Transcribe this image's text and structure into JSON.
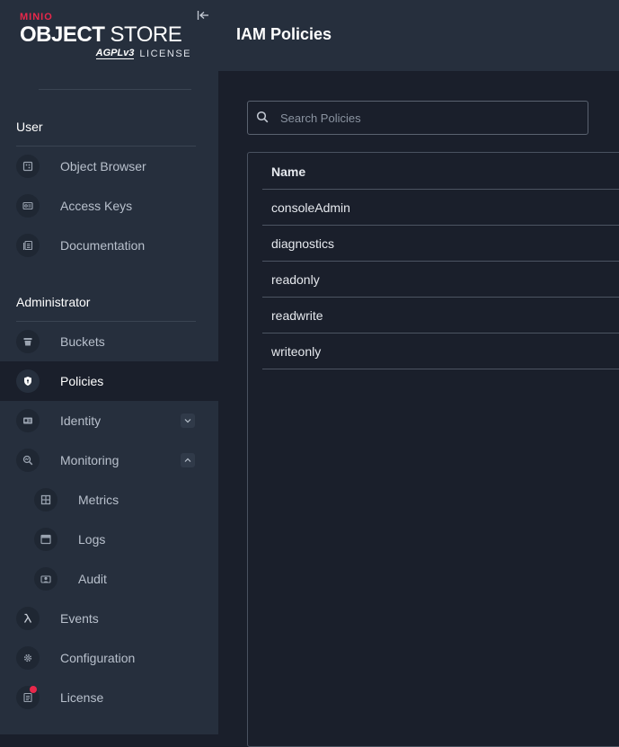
{
  "brand": {
    "company": "MINIO",
    "product_bold": "OBJECT",
    "product_thin": "STORE",
    "license_badge": "AGPLv3",
    "license_word": "LICENSE"
  },
  "sidebar": {
    "sections": {
      "user": "User",
      "administrator": "Administrator"
    },
    "user_items": [
      {
        "label": "Object Browser",
        "icon": "object-browser-icon"
      },
      {
        "label": "Access Keys",
        "icon": "access-keys-icon"
      },
      {
        "label": "Documentation",
        "icon": "documentation-icon"
      }
    ],
    "admin_items": [
      {
        "label": "Buckets",
        "icon": "bucket-icon"
      },
      {
        "label": "Policies",
        "icon": "shield-icon",
        "active": true
      },
      {
        "label": "Identity",
        "icon": "id-card-icon",
        "expanded": false
      },
      {
        "label": "Monitoring",
        "icon": "magnifier-icon",
        "expanded": true
      },
      {
        "label": "Metrics",
        "icon": "grid-icon",
        "sub": true
      },
      {
        "label": "Logs",
        "icon": "logs-icon",
        "sub": true
      },
      {
        "label": "Audit",
        "icon": "audit-icon",
        "sub": true
      },
      {
        "label": "Events",
        "icon": "lambda-icon"
      },
      {
        "label": "Configuration",
        "icon": "gear-icon"
      },
      {
        "label": "License",
        "icon": "license-icon",
        "notification": true
      }
    ]
  },
  "header": {
    "title": "IAM Policies"
  },
  "search": {
    "placeholder": "Search Policies",
    "value": ""
  },
  "policies_table": {
    "columns": [
      "Name"
    ],
    "rows": [
      "consoleAdmin",
      "diagnostics",
      "readonly",
      "readwrite",
      "writeonly"
    ]
  },
  "colors": {
    "accent": "#e8284b",
    "sidebar_bg": "#262f3d",
    "main_bg": "#1a1f2b"
  }
}
